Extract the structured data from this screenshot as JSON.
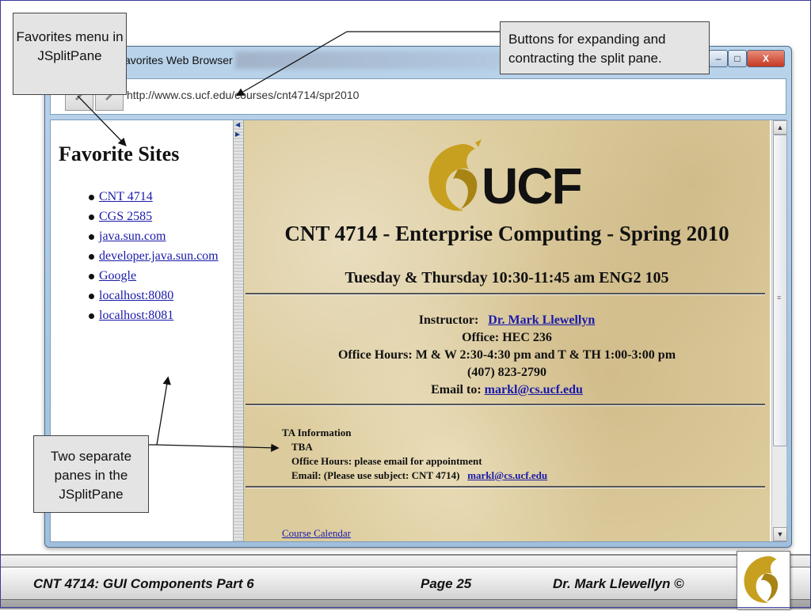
{
  "window": {
    "title": "avorites Web Browser",
    "controls": {
      "minimize": "–",
      "maximize": "□",
      "close": "X"
    }
  },
  "navbar": {
    "url": "http://www.cs.ucf.edu/courses/cnt4714/spr2010"
  },
  "left_pane": {
    "heading": "Favorite Sites",
    "favorites": [
      "CNT 4714",
      "CGS 2585",
      "java.sun.com",
      "developer.java.sun.com",
      "Google",
      "localhost:8080",
      "localhost:8081"
    ]
  },
  "splitter": {
    "up_arrow": "◀",
    "down_arrow": "▶"
  },
  "right_pane": {
    "logo_text": "UCF",
    "course_title": "CNT 4714 - Enterprise Computing - Spring 2010",
    "schedule": "Tuesday & Thursday   10:30-11:45 am ENG2 105",
    "instructor_label": "Instructor:",
    "instructor_name": "Dr. Mark Llewellyn",
    "office": "Office: HEC 236",
    "office_hours": "Office Hours: M & W 2:30-4:30 pm and T & TH 1:00-3:00 pm",
    "phone": "(407) 823-2790",
    "email_label": "Email to:",
    "email": "markl@cs.ucf.edu",
    "ta_heading": "TA Information",
    "ta_name": "TBA",
    "ta_hours": "Office Hours: please email for appointment",
    "ta_email_label": "Email: (Please use subject: CNT 4714)",
    "ta_email": "markl@cs.ucf.edu",
    "calendar_link": "Course Calendar"
  },
  "scrollbar": {
    "up": "▲",
    "down": "▼",
    "grip": "≡"
  },
  "callouts": {
    "favorites_menu": "Favorites menu in JSplitPane",
    "split_buttons": "Buttons for expanding and contracting the split pane.",
    "two_panes": "Two separate panes in the JSplitPane"
  },
  "footer": {
    "course": "CNT 4714: GUI Components Part 6",
    "page": "Page 25",
    "author": "Dr. Mark Llewellyn ©"
  },
  "colors": {
    "link": "#1a1aaa",
    "ucf_gold": "#c8a020",
    "parchment": "#dccb9c"
  }
}
